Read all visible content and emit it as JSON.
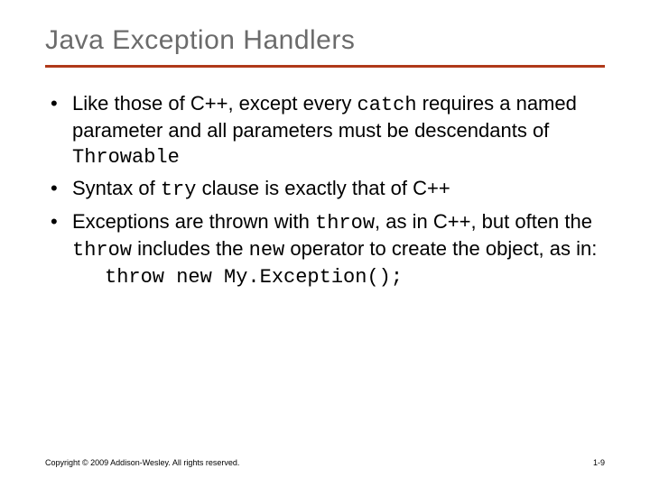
{
  "title": "Java Exception Handlers",
  "bullets": {
    "b1": {
      "t1": "Like those of C++, except every ",
      "code1": "catch",
      "t2": " requires a named parameter and all parameters must be descendants of ",
      "code2": "Throwable"
    },
    "b2": {
      "t1": "Syntax of ",
      "code1": "try",
      "t2": " clause is exactly that of C++"
    },
    "b3": {
      "t1": "Exceptions are thrown with ",
      "code1": "throw",
      "t2": ", as in C++, but often the ",
      "code2": "throw",
      "t3": " includes the ",
      "code3": "new",
      "t4": " operator to create the object, as in:"
    }
  },
  "code_line": "throw new My.Exception();",
  "footer": {
    "copyright": "Copyright © 2009 Addison-Wesley. All rights reserved.",
    "page": "1-9"
  }
}
